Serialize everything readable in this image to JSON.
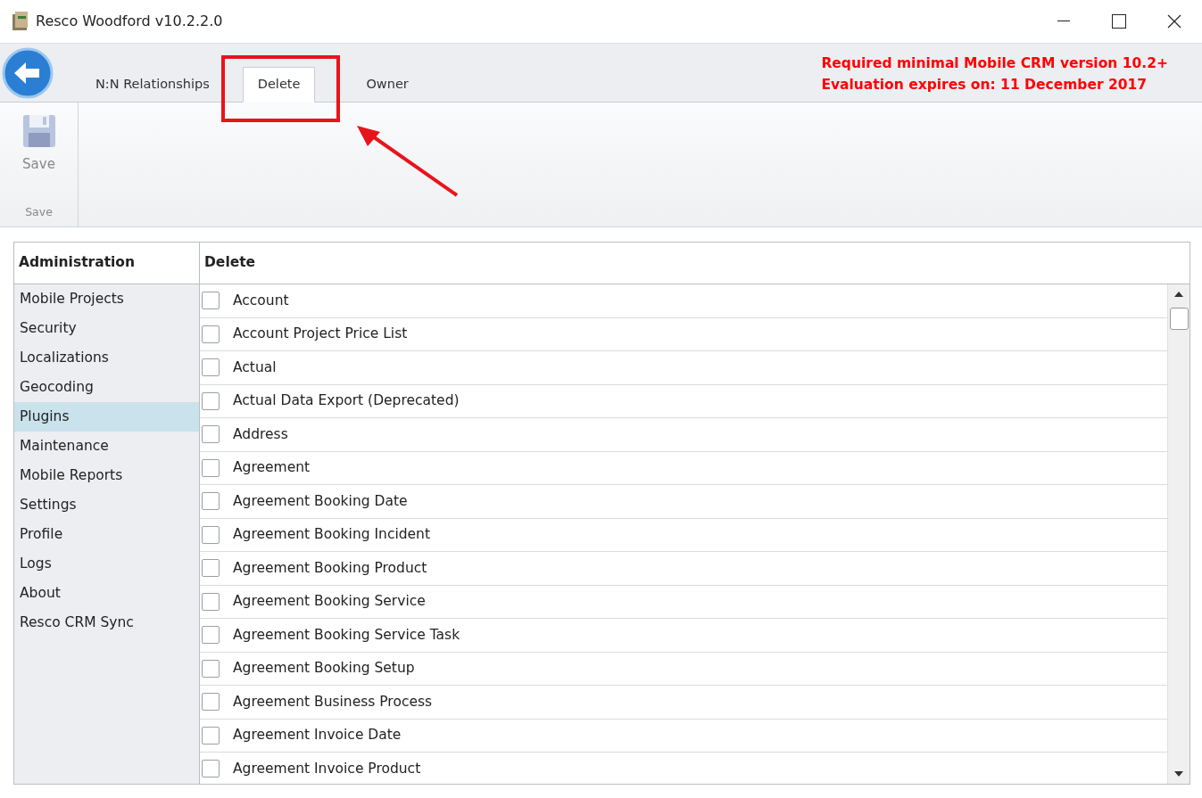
{
  "window": {
    "title": "Resco Woodford v10.2.2.0"
  },
  "tabs": [
    {
      "label": "N:N Relationships",
      "selected": false
    },
    {
      "label": "Delete",
      "selected": true
    },
    {
      "label": "Owner",
      "selected": false
    }
  ],
  "notices": [
    "Required minimal Mobile CRM version 10.2+",
    "Evaluation expires on: 11 December 2017"
  ],
  "ribbon": {
    "button": "Save",
    "group": "Save"
  },
  "sidebar": {
    "title": "Administration",
    "items": [
      {
        "label": "Mobile Projects",
        "selected": false
      },
      {
        "label": "Security",
        "selected": false
      },
      {
        "label": "Localizations",
        "selected": false
      },
      {
        "label": "Geocoding",
        "selected": false
      },
      {
        "label": "Plugins",
        "selected": true
      },
      {
        "label": "Maintenance",
        "selected": false
      },
      {
        "label": "Mobile Reports",
        "selected": false
      },
      {
        "label": "Settings",
        "selected": false
      },
      {
        "label": "Profile",
        "selected": false
      },
      {
        "label": "Logs",
        "selected": false
      },
      {
        "label": "About",
        "selected": false
      },
      {
        "label": "Resco CRM Sync",
        "selected": false
      }
    ]
  },
  "list": {
    "title": "Delete",
    "rows": [
      {
        "label": "Account",
        "checked": false
      },
      {
        "label": "Account Project Price List",
        "checked": false
      },
      {
        "label": "Actual",
        "checked": false
      },
      {
        "label": "Actual Data Export (Deprecated)",
        "checked": false
      },
      {
        "label": "Address",
        "checked": false
      },
      {
        "label": "Agreement",
        "checked": false
      },
      {
        "label": "Agreement Booking Date",
        "checked": false
      },
      {
        "label": "Agreement Booking Incident",
        "checked": false
      },
      {
        "label": "Agreement Booking Product",
        "checked": false
      },
      {
        "label": "Agreement Booking Service",
        "checked": false
      },
      {
        "label": "Agreement Booking Service Task",
        "checked": false
      },
      {
        "label": "Agreement Booking Setup",
        "checked": false
      },
      {
        "label": "Agreement Business Process",
        "checked": false
      },
      {
        "label": "Agreement Invoice Date",
        "checked": false
      },
      {
        "label": "Agreement Invoice Product",
        "checked": false
      }
    ]
  }
}
